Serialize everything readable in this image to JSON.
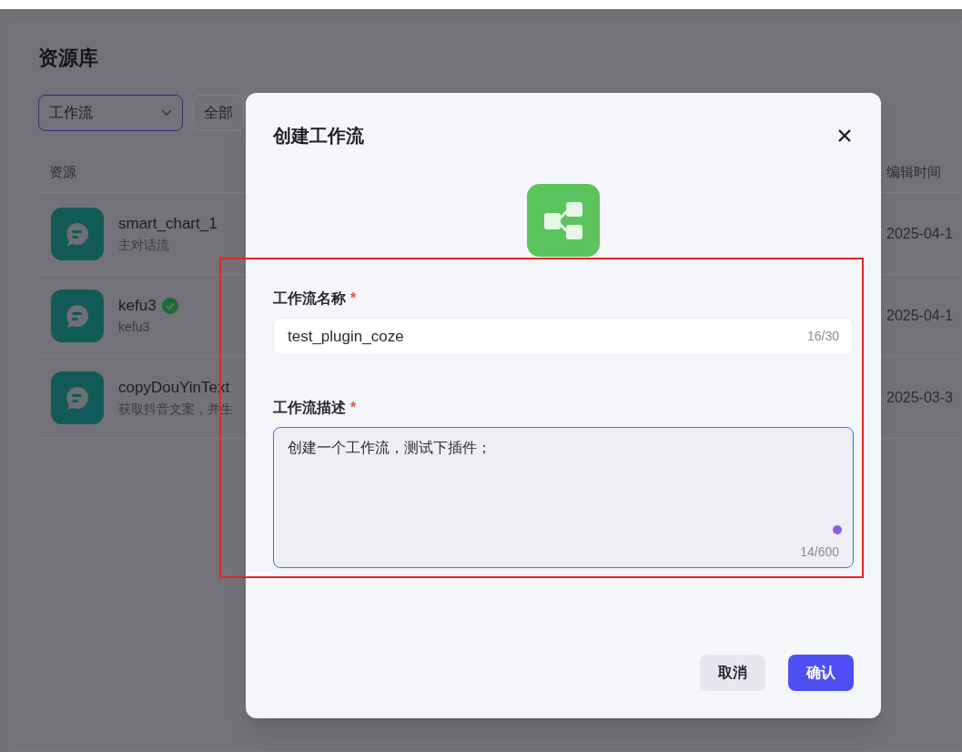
{
  "page": {
    "title": "资源库"
  },
  "filters": [
    {
      "kind": "dropdown",
      "label": "工作流",
      "selected": true
    },
    {
      "kind": "button",
      "label": "全部",
      "selected": false
    }
  ],
  "table": {
    "columns": [
      "资源",
      "编辑时间"
    ],
    "rows": [
      {
        "name": "smart_chart_1",
        "description": "主对话流",
        "verified": false,
        "edited": "2025-04-1"
      },
      {
        "name": "kefu3",
        "description": "kefu3",
        "verified": true,
        "edited": "2025-04-1"
      },
      {
        "name": "copyDouYinText",
        "description": "获取抖音文案，并生",
        "verified": false,
        "edited": "2025-03-3"
      }
    ]
  },
  "dialog": {
    "title": "创建工作流",
    "fields": [
      {
        "kind": "input",
        "label": "工作流名称",
        "required_mark": "*",
        "value": "test_plugin_coze",
        "count": "16/30",
        "focused": false
      },
      {
        "kind": "textarea",
        "label": "工作流描述",
        "required_mark": "*",
        "value": "创建一个工作流，测试下插件；",
        "count": "14/600",
        "focused": true
      }
    ],
    "buttons": [
      {
        "label": "取消",
        "kind": "secondary"
      },
      {
        "label": "确认",
        "kind": "primary"
      }
    ]
  }
}
